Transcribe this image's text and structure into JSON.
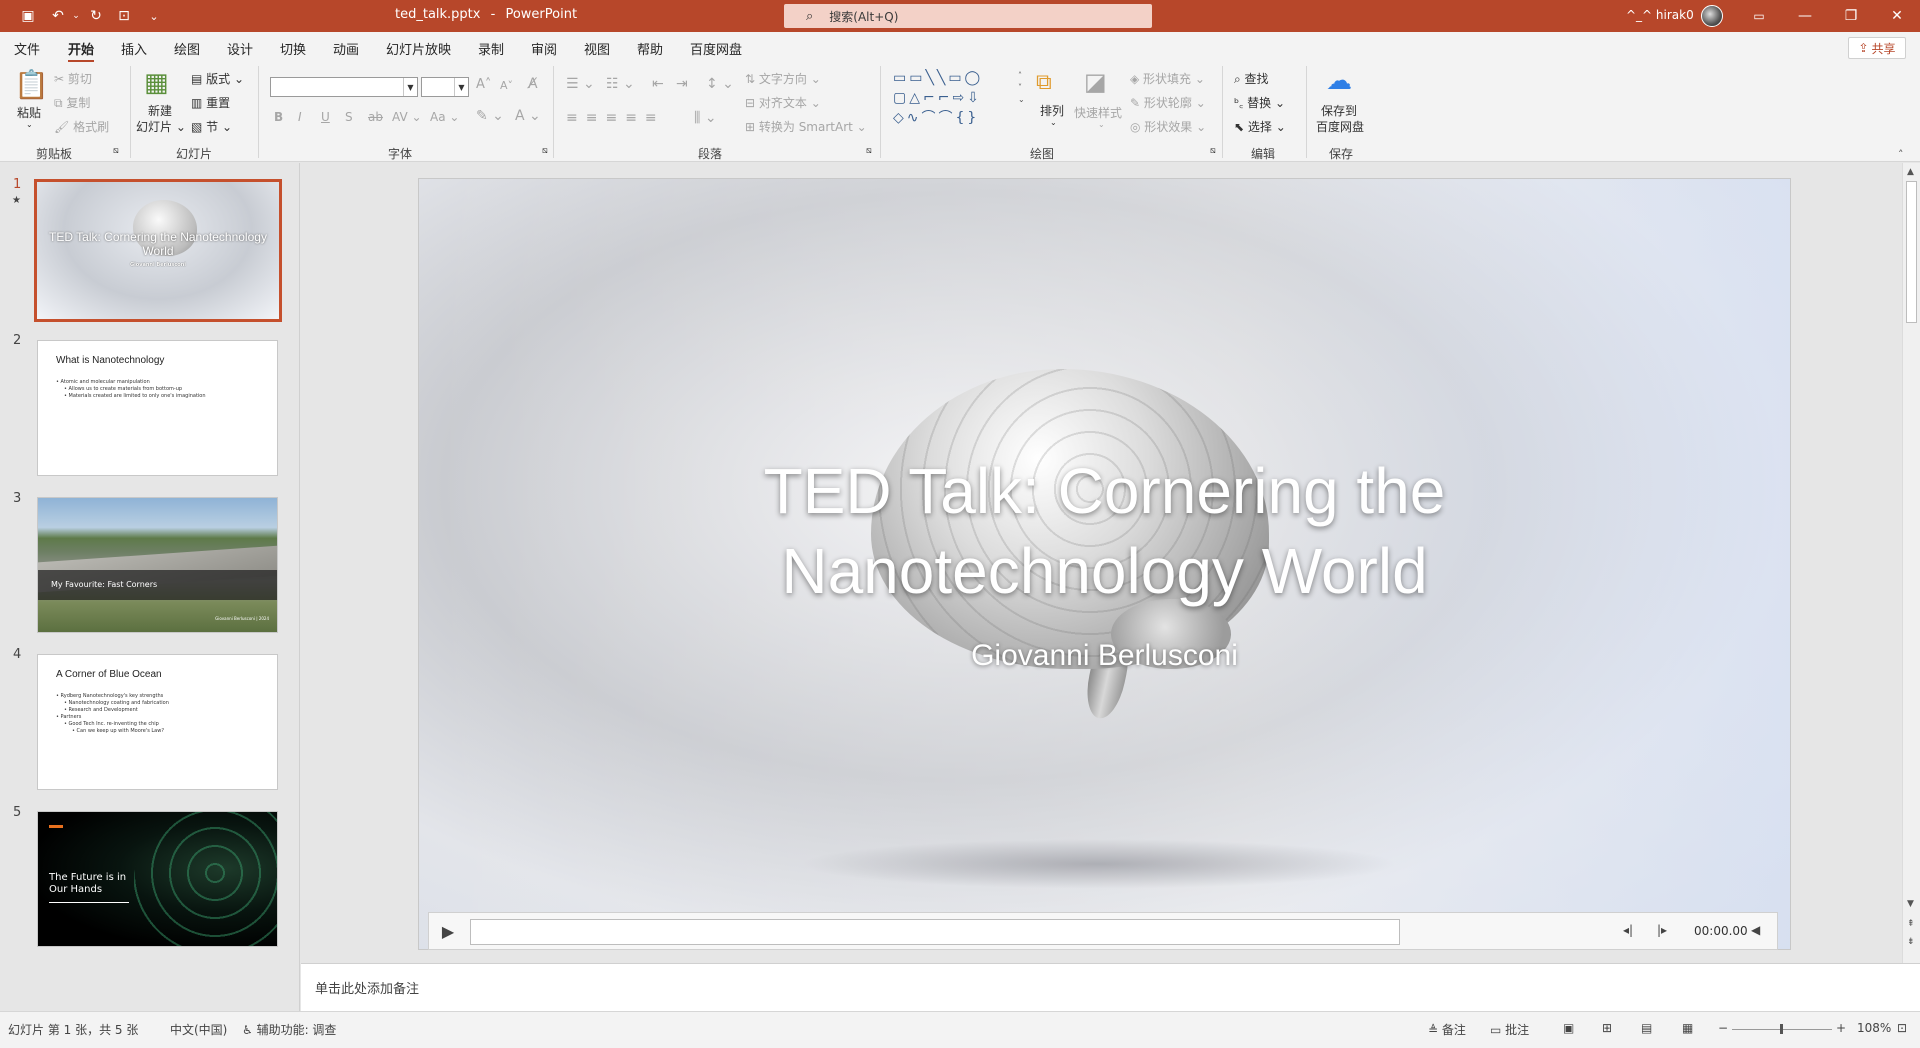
{
  "titlebar": {
    "filename": "ted_talk.pptx",
    "separator": "-",
    "app": "PowerPoint",
    "search_placeholder": "搜索(Alt+Q)",
    "user": "^_^ hirak0"
  },
  "menu": {
    "tabs": [
      "文件",
      "开始",
      "插入",
      "绘图",
      "设计",
      "切换",
      "动画",
      "幻灯片放映",
      "录制",
      "审阅",
      "视图",
      "帮助",
      "百度网盘"
    ],
    "active": "开始",
    "share": "共享"
  },
  "ribbon": {
    "clipboard": {
      "paste": "粘贴",
      "cut": "剪切",
      "copy": "复制",
      "format_painter": "格式刷",
      "label": "剪贴板"
    },
    "slides": {
      "new_slide_1": "新建",
      "new_slide_2": "幻灯片",
      "layout": "版式",
      "reset": "重置",
      "section": "节",
      "label": "幻灯片"
    },
    "font": {
      "label": "字体",
      "bold": "B",
      "italic": "I",
      "underline": "U",
      "shadow": "S",
      "strike": "ab",
      "spacing": "AV",
      "case": "Aa",
      "grow": "A",
      "shrink": "A"
    },
    "paragraph": {
      "label": "段落",
      "text_direction": "文字方向",
      "align_text": "对齐文本",
      "smartart": "转换为 SmartArt"
    },
    "drawing": {
      "label": "绘图",
      "arrange": "排列",
      "quick_styles": "快速样式",
      "fill": "形状填充",
      "outline": "形状轮廓",
      "effects": "形状效果"
    },
    "editing": {
      "label": "编辑",
      "find": "查找",
      "replace": "替换",
      "select": "选择"
    },
    "save": {
      "label": "保存",
      "save_to_1": "保存到",
      "save_to_2": "百度网盘"
    }
  },
  "thumbnails": {
    "numbers": [
      "1",
      "2",
      "3",
      "4",
      "5"
    ],
    "star": "★",
    "slide1": {
      "title": "TED Talk: Cornering the Nanotechnology World",
      "subtitle": "Giovanni Berlusconi"
    },
    "slide2": {
      "title": "What is Nanotechnology",
      "b1": "• Atomic and molecular manipulation",
      "b2": "• Allows us to create materials from bottom-up",
      "b3": "• Materials created are limited to only one's imagination"
    },
    "slide3": {
      "title": "My Favourite: Fast Corners",
      "credit": "Giovanni Berlusconi | 2024"
    },
    "slide4": {
      "title": "A Corner of Blue Ocean",
      "b1": "• Rydberg Nanotechnology's key strengths",
      "b2": "• Nanotechnology coating and fabrication",
      "b3": "• Research and Development",
      "b4": "• Partners",
      "b5": "• Good Tech Inc. re-inventing the chip",
      "b6": "• Can we keep up with Moore's Law?"
    },
    "slide5": {
      "title": "The Future is in Our Hands"
    }
  },
  "slide": {
    "title_line1": "TED Talk: Cornering the",
    "title_line2": "Nanotechnology World",
    "subtitle": "Giovanni Berlusconi"
  },
  "media": {
    "time": "00:00.00"
  },
  "notes": {
    "placeholder": "单击此处添加备注"
  },
  "status": {
    "slide_info": "幻灯片 第 1 张，共 5 张",
    "language": "中文(中国)",
    "accessibility": "辅助功能: 调查",
    "notes": "备注",
    "comments": "批注",
    "zoom": "108%"
  },
  "colors": {
    "accent": "#b7472a",
    "selected_border": "#c5502d"
  }
}
